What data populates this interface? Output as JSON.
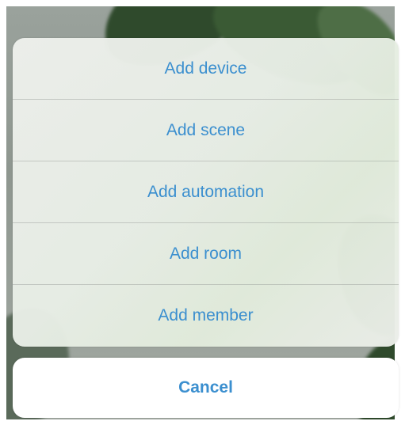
{
  "action_sheet": {
    "items": [
      {
        "label": "Add device"
      },
      {
        "label": "Add scene"
      },
      {
        "label": "Add automation"
      },
      {
        "label": "Add room"
      },
      {
        "label": "Add member"
      }
    ],
    "cancel_label": "Cancel",
    "accent_color": "#3b8fcf"
  }
}
